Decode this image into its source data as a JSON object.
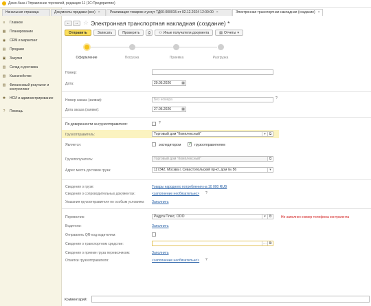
{
  "titlebar": {
    "title": "Демо-база / Управление торговлей, редакция 11  (1С:Предприятие)"
  },
  "tabs": [
    {
      "label": "Начальная страница"
    },
    {
      "label": "Документы продажи (все)"
    },
    {
      "label": "Реализация товаров и услуг ТД00-000015 от 02.12.2024 12:00:00"
    },
    {
      "label": "Электронная транспортная накладная (создание)"
    }
  ],
  "sidebar": {
    "items": [
      {
        "label": "Главное",
        "icon": "menu-icon"
      },
      {
        "label": "Планирование",
        "icon": "calendar-icon"
      },
      {
        "label": "CRM и маркетинг",
        "icon": "crm-icon"
      },
      {
        "label": "Продажи",
        "icon": "sales-icon"
      },
      {
        "label": "Закупки",
        "icon": "cart-icon"
      },
      {
        "label": "Склад и доставка",
        "icon": "warehouse-icon"
      },
      {
        "label": "Казначейство",
        "icon": "treasury-icon"
      },
      {
        "label": "Финансовый результат и контроллинг",
        "icon": "chart-icon"
      },
      {
        "label": "НСИ и администрирование",
        "icon": "gear-icon"
      },
      {
        "label": "Помощь",
        "icon": "help-icon"
      }
    ]
  },
  "header": {
    "title": "Электронная транспортная накладная (создание) *"
  },
  "toolbar": {
    "send": "Отправить",
    "save": "Записать",
    "check": "Проверить",
    "other_recipients": "Иные получатели документа",
    "reports": "Отчеты"
  },
  "steps": [
    {
      "label": "Оформление",
      "active": true
    },
    {
      "label": "Погрузка",
      "active": false
    },
    {
      "label": "Приемка",
      "active": false
    },
    {
      "label": "Разгрузка",
      "active": false
    }
  ],
  "form": {
    "number_label": "Номер:",
    "number_value": "",
    "date_label": "Дата:",
    "date_value": "29.05.2026",
    "order_number_label": "Номер заказа (заявки):",
    "order_number_placeholder": "Без номера",
    "order_date_label": "Дата заказа (заявки):",
    "order_date_value": "27.05.2026",
    "proxy_label": "По доверенности за грузоотправителя:",
    "shipper_label": "Грузоотправитель:",
    "shipper_value": "Торговый дом \"Комплексный\"",
    "is_label": "Является:",
    "is_forwarder": "экспедитором",
    "is_shipper": "грузоотправителем",
    "consignee_label": "Грузополучатель:",
    "consignee_value": "Торговый дом \"Комплексный\"",
    "address_label": "Адрес места доставки груза:",
    "address_value": "117342, Москва г, Севастопольский пр-кт, дом № 56",
    "cargo_label": "Сведения о грузе:",
    "cargo_link": "Товары народного потребления на 10 000 RUB",
    "docs_label": "Сведения о сопроводительных документах:",
    "docs_link": "<заполнение необязательно>",
    "instructions_label": "Указания грузоотправителя по особым условиям:",
    "instructions_link": "Заполнить",
    "carrier_label": "Перевозчик:",
    "carrier_value": "Радуга Плюс, ООО",
    "carrier_warning": "Не заполнен номер телефона контрагента",
    "drivers_label": "Водители:",
    "drivers_link": "Заполнить",
    "qr_label": "Отправлять QR-код водителям:",
    "vehicle_label": "Сведения о транспортном средстве:",
    "vehicle_value": "",
    "acceptance_label": "Сведения о приеме груза перевозчиком:",
    "acceptance_link": "Заполнить",
    "marks_label": "Отметки грузоотправителя:",
    "marks_link": "<заполнение необязательно>",
    "comment_label": "Комментарий:",
    "comment_value": ""
  },
  "colors": {
    "accent": "#fcdf5a",
    "sidebar": "#f7f4e4",
    "link": "#2b63a8",
    "warning": "#d21b1b"
  }
}
